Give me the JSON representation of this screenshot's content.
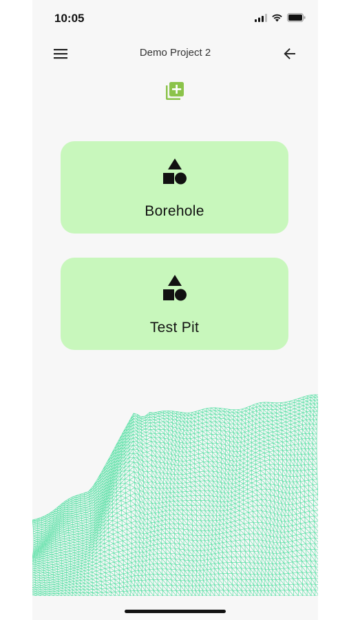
{
  "status_bar": {
    "time": "10:05",
    "icons": [
      "signal-icon",
      "wifi-icon",
      "battery-icon"
    ]
  },
  "app_bar": {
    "title": "Demo Project 2",
    "menu_icon": "menu-icon",
    "back_icon": "arrow-back-icon"
  },
  "actions": {
    "add_icon": "library-add-icon"
  },
  "cards": [
    {
      "label": "Borehole",
      "icon": "shapes-icon"
    },
    {
      "label": "Test Pit",
      "icon": "shapes-icon"
    }
  ],
  "colors": {
    "card_background": "#c8f7bc",
    "accent_green": "#8bc34a",
    "terrain_mesh": "#3ddc97",
    "background": "#f7f7f7"
  }
}
